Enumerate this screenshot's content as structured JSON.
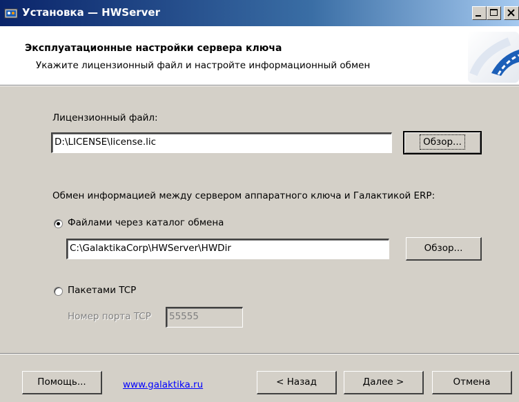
{
  "window": {
    "title": "Установка — HWServer",
    "controls": [
      "minimize",
      "maximize",
      "close"
    ]
  },
  "header": {
    "title": "Эксплуатационные настройки сервера ключа",
    "subtitle": "Укажите лицензионный файл и настройте информационный обмен"
  },
  "license": {
    "label": "Лицензионный файл:",
    "value": "D:\\LICENSE\\license.lic",
    "browse_label": "Обзор..."
  },
  "exchange": {
    "label": "Обмен информацией между сервером аппаратного ключа и Галактикой ERP:",
    "option_files": {
      "label": "Файлами через каталог обмена",
      "selected": true,
      "path": "C:\\GalaktikaCorp\\HWServer\\HWDir",
      "browse_label": "Обзор..."
    },
    "option_tcp": {
      "label": "Пакетами TCP",
      "selected": false,
      "port_label": "Номер порта TCP",
      "port_value": "55555"
    }
  },
  "footer": {
    "help_label": "Помощь...",
    "link_text": "www.galaktika.ru",
    "back_label": "< Назад",
    "next_label": "Далее >",
    "cancel_label": "Отмена"
  },
  "colors": {
    "title_start": "#0a246a",
    "title_end": "#a6caf0",
    "face": "#d4d0c8",
    "link": "#0000ff",
    "logo_blue": "#1c5fb8"
  }
}
